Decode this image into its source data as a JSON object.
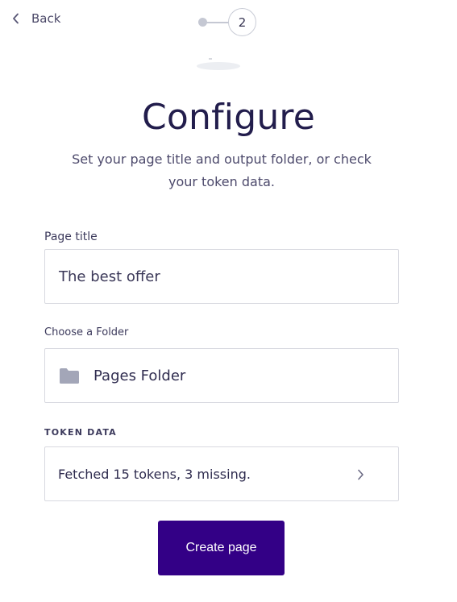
{
  "nav": {
    "back_label": "Back"
  },
  "stepper": {
    "current_step": "2"
  },
  "heading": {
    "title": "Configure",
    "subtitle": "Set your page title and output folder, or check your token data."
  },
  "form": {
    "page_title": {
      "label": "Page title",
      "value": "The best offer"
    },
    "folder": {
      "label": "Choose a Folder",
      "value": "Pages Folder",
      "icon": "folder-icon"
    },
    "token_data": {
      "label": "TOKEN DATA",
      "value": "Fetched 15 tokens, 3 missing.",
      "icon": "chevron-right-icon"
    }
  },
  "actions": {
    "create_label": "Create page"
  },
  "colors": {
    "primary": "#330086",
    "heading": "#221d4c",
    "border": "#d8d9e0",
    "icon_gray": "#a3a6b8"
  }
}
